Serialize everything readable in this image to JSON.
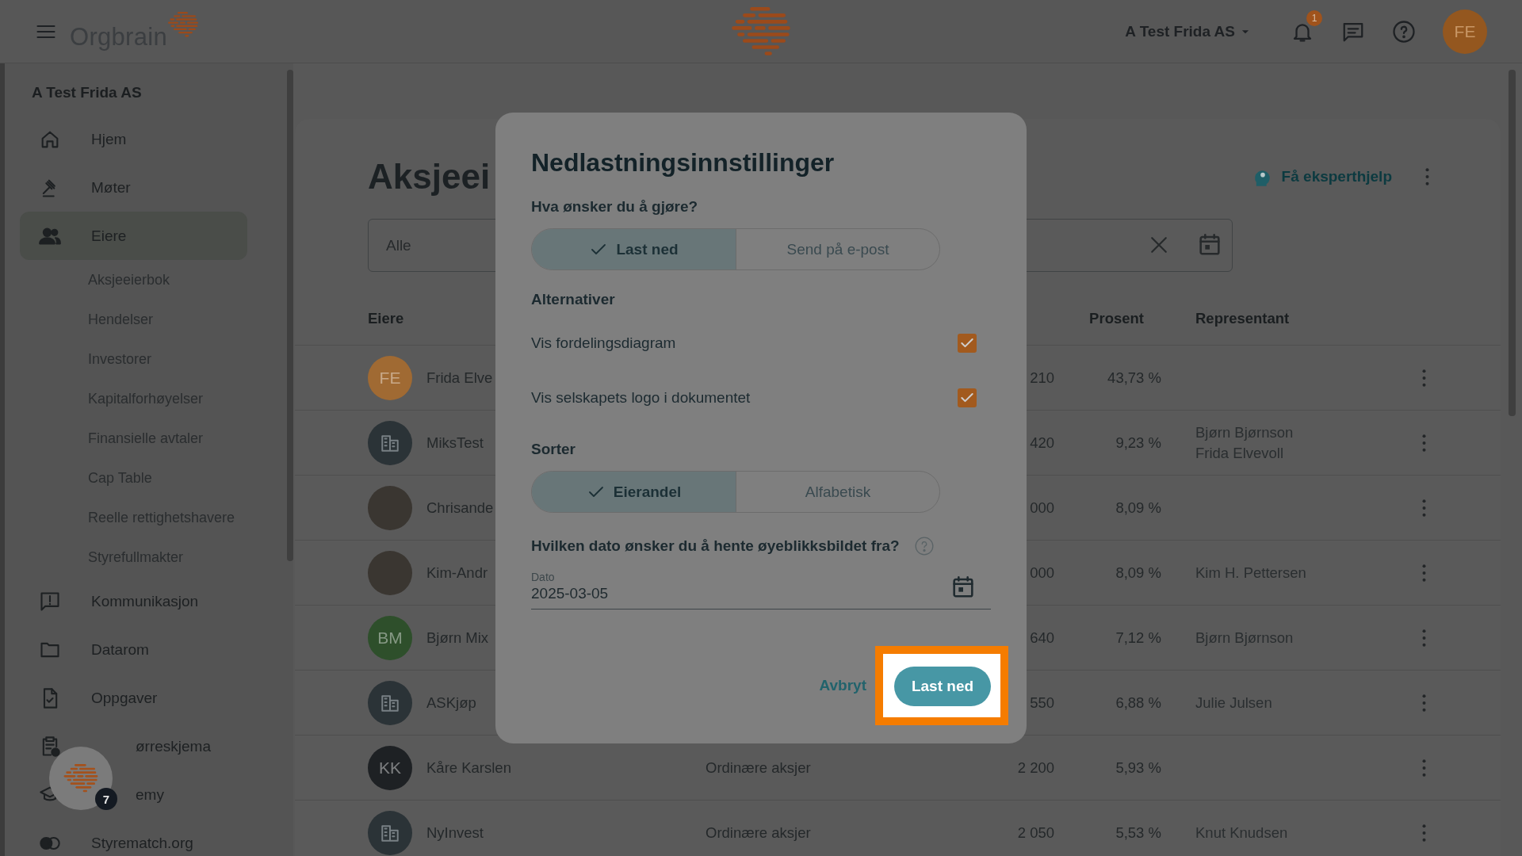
{
  "top_bar": {
    "logo_text": "Orgbrain",
    "company_selector": "A Test Frida AS",
    "notification_count": "1",
    "avatar_initials": "FE"
  },
  "sidebar": {
    "company": "A Test Frida AS",
    "items": [
      {
        "label": "Hjem",
        "selected": false,
        "covered": false
      },
      {
        "label": "Møter",
        "selected": false,
        "covered": false
      },
      {
        "label": "Eiere",
        "selected": true,
        "covered": false,
        "children": [
          {
            "label": "Aksjeeierbok",
            "selected": false
          },
          {
            "label": "Hendelser",
            "selected": false
          },
          {
            "label": "Investorer",
            "selected": false
          },
          {
            "label": "Kapitalforhøyelser",
            "selected": false
          },
          {
            "label": "Finansielle avtaler",
            "selected": false
          },
          {
            "label": "Cap Table",
            "selected": false
          },
          {
            "label": "Reelle rettighetshavere",
            "selected": false
          },
          {
            "label": "Styrefullmakter",
            "selected": false
          }
        ]
      },
      {
        "label": "Kommunikasjon",
        "selected": false,
        "covered": false
      },
      {
        "label": "Datarom",
        "selected": false,
        "covered": false
      },
      {
        "label": "Oppgaver",
        "selected": false,
        "covered": false
      },
      {
        "label": "ørreskjema",
        "selected": false,
        "covered": true
      },
      {
        "label": "emy",
        "selected": false,
        "covered": true
      },
      {
        "label": "Styrematch.org",
        "selected": false,
        "covered": false
      }
    ]
  },
  "help_bubble": {
    "badge": "7"
  },
  "main": {
    "title": "Aksjeei",
    "expert_help": "Få eksperthjelp",
    "filter": {
      "value": "Alle"
    },
    "table": {
      "columns": [
        {
          "label": "Eiere"
        },
        {
          "label": "Prosent"
        },
        {
          "label": "Representant"
        }
      ],
      "rows": [
        {
          "name": "Frida Elve",
          "avatar": {
            "kind": "initials",
            "initials": "FE",
            "color": "#a06a33"
          },
          "shares": "210",
          "percent": "43,73 %",
          "representatives": []
        },
        {
          "name": "MiksTest",
          "avatar": {
            "kind": "company"
          },
          "shares": "420",
          "percent": "9,23 %",
          "representatives": [
            "Bjørn Bjørnson",
            "Frida Elvevoll"
          ]
        },
        {
          "name": "Chrisande",
          "avatar": {
            "kind": "photo"
          },
          "shares": "000",
          "percent": "8,09 %",
          "representatives": []
        },
        {
          "name": "Kim-Andr",
          "avatar": {
            "kind": "photo"
          },
          "shares": "000",
          "percent": "8,09 %",
          "representatives": [
            "Kim H. Pettersen"
          ]
        },
        {
          "name": "Bjørn Mix",
          "avatar": {
            "kind": "initials",
            "initials": "BM",
            "color": "#2e4f2b"
          },
          "shares": "640",
          "percent": "7,12 %",
          "representatives": [
            "Bjørn Bjørnson"
          ]
        },
        {
          "name": "ASKjøp",
          "avatar": {
            "kind": "company"
          },
          "shares": "550",
          "percent": "6,88 %",
          "representatives": [
            "Julie Julsen"
          ]
        },
        {
          "name": "Kåre Karslen",
          "avatar": {
            "kind": "initials",
            "initials": "KK",
            "color": "#1e2124"
          },
          "share_class": "Ordinære aksjer",
          "shares": "2 200",
          "percent": "5,93 %",
          "representatives": []
        },
        {
          "name": "NyInvest",
          "avatar": {
            "kind": "company"
          },
          "share_class": "Ordinære aksjer",
          "shares": "2 050",
          "percent": "5,53 %",
          "representatives": [
            "Knut Knudsen"
          ]
        }
      ]
    }
  },
  "dialog": {
    "title": "Nedlastningsinnstillinger",
    "action_question": "Hva ønsker du å gjøre?",
    "action_options": [
      {
        "label": "Last ned",
        "selected": true
      },
      {
        "label": "Send på e-post",
        "selected": false
      }
    ],
    "options_heading": "Alternativer",
    "options": [
      {
        "label": "Vis fordelingsdiagram",
        "checked": true
      },
      {
        "label": "Vis selskapets logo i dokumentet",
        "checked": true
      }
    ],
    "sort_heading": "Sorter",
    "sort_options": [
      {
        "label": "Eierandel",
        "selected": true
      },
      {
        "label": "Alfabetisk",
        "selected": false
      }
    ],
    "date_question": "Hvilken dato ønsker du å hente øyeblikksbildet fra?",
    "date_field": {
      "label": "Dato",
      "value": "2025-03-05"
    },
    "cancel": "Avbryt",
    "confirm": "Last ned",
    "confirm_highlighted": true
  }
}
